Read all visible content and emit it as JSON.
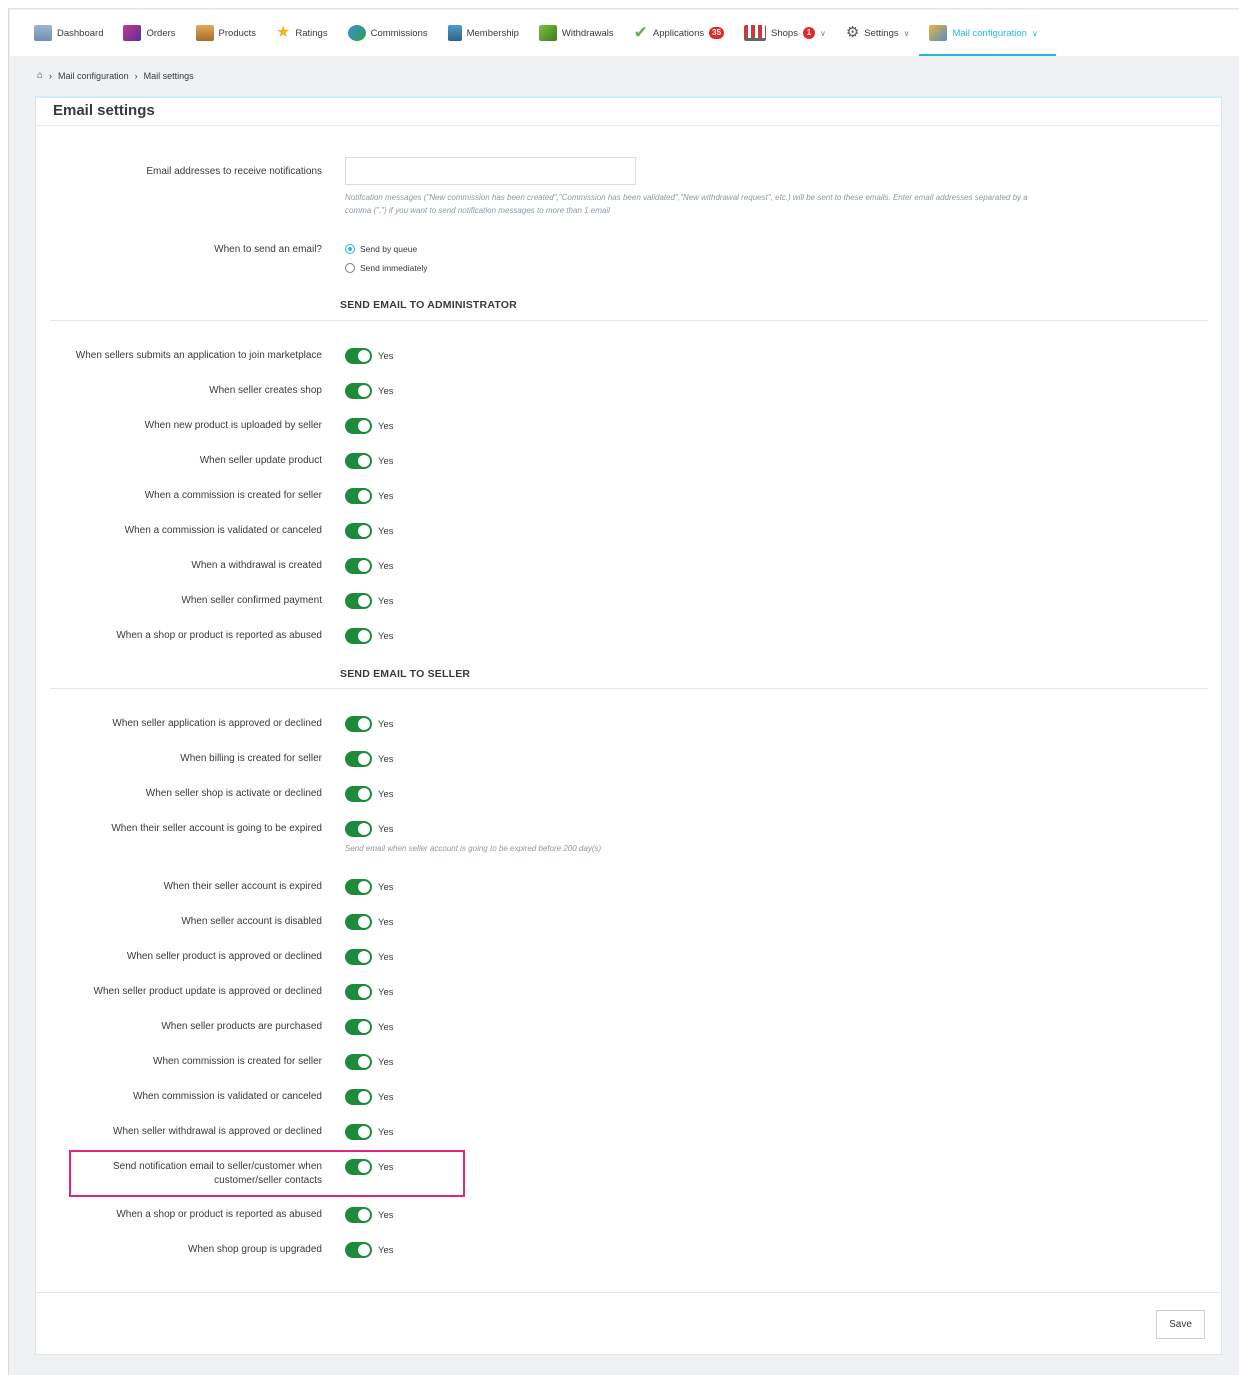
{
  "nav": {
    "items": [
      {
        "label": "Dashboard",
        "icon": "dashboard-icon",
        "color": "#6b8fb3"
      },
      {
        "label": "Orders",
        "icon": "orders-icon",
        "color": "#8a3b7a"
      },
      {
        "label": "Products",
        "icon": "products-icon",
        "color": "#c48a3e"
      },
      {
        "label": "Ratings",
        "icon": "star-icon",
        "color": "#f2b21c"
      },
      {
        "label": "Commissions",
        "icon": "commissions-icon",
        "color": "#3b8fd6"
      },
      {
        "label": "Membership",
        "icon": "membership-icon",
        "color": "#3a7fa8"
      },
      {
        "label": "Withdrawals",
        "icon": "withdrawals-icon",
        "color": "#5a9e2f"
      },
      {
        "label": "Applications",
        "icon": "applications-icon",
        "badge": "35",
        "color": "#6cae3d"
      },
      {
        "label": "Shops",
        "icon": "shops-icon",
        "badge": "1",
        "caret": true,
        "color": "#c43d3d"
      },
      {
        "label": "Settings",
        "icon": "settings-icon",
        "caret": true,
        "color": "#6a6a6a"
      },
      {
        "label": "Mail configuration",
        "icon": "mail-configuration-icon",
        "caret": true,
        "active": true,
        "color": "#4a90c8"
      }
    ]
  },
  "breadcrumb": {
    "home_icon": "home-icon",
    "items": [
      "Mail configuration",
      "Mail settings"
    ]
  },
  "panel": {
    "title": "Email settings"
  },
  "email_field": {
    "label": "Email addresses to receive notifications",
    "value": "",
    "help_line1": "Notifcation messages (\"New commission has been created\",\"Commission has been validated\",\"New withdrawal request\", etc.) will be sent to these emails. Enter email addresses separated by a",
    "help_line2": "comma (\",\") if you want to send notification messages to more than 1 email"
  },
  "send_when": {
    "label": "When to send an email?",
    "options": [
      {
        "label": "Send by queue",
        "selected": true
      },
      {
        "label": "Send immediately",
        "selected": false
      }
    ]
  },
  "admin_section": {
    "title": "SEND EMAIL TO ADMINISTRATOR",
    "rows": [
      {
        "label": "When sellers submits an application to join marketplace",
        "state": "Yes"
      },
      {
        "label": "When seller creates shop",
        "state": "Yes"
      },
      {
        "label": "When new product is uploaded by seller",
        "state": "Yes"
      },
      {
        "label": "When seller update product",
        "state": "Yes"
      },
      {
        "label": "When a commission is created for seller",
        "state": "Yes"
      },
      {
        "label": "When a commission is validated or canceled",
        "state": "Yes"
      },
      {
        "label": "When a withdrawal is created",
        "state": "Yes"
      },
      {
        "label": "When seller confirmed payment",
        "state": "Yes"
      },
      {
        "label": "When a shop or product is reported as abused",
        "state": "Yes"
      }
    ]
  },
  "seller_section": {
    "title": "SEND EMAIL TO SELLER",
    "rows": [
      {
        "label": "When seller application is approved or declined",
        "state": "Yes"
      },
      {
        "label": "When billing is created for seller",
        "state": "Yes"
      },
      {
        "label": "When seller shop is activate or declined",
        "state": "Yes"
      },
      {
        "label": "When their seller account is going to be expired",
        "state": "Yes",
        "help": "Send email when seller account is going to be expired before 200 day(s)"
      },
      {
        "label": "When their seller account is expired",
        "state": "Yes"
      },
      {
        "label": "When seller account is disabled",
        "state": "Yes"
      },
      {
        "label": "When seller product is approved or declined",
        "state": "Yes"
      },
      {
        "label": "When seller product update is approved or declined",
        "state": "Yes"
      },
      {
        "label": "When seller products are purchased",
        "state": "Yes"
      },
      {
        "label": "When commission is created for seller",
        "state": "Yes"
      },
      {
        "label": "When commission is validated or canceled",
        "state": "Yes"
      },
      {
        "label": "When seller withdrawal is approved or declined",
        "state": "Yes"
      },
      {
        "label_line1": "Send notification email to seller/customer when",
        "label_line2": "customer/seller contacts",
        "state": "Yes",
        "highlighted": true
      },
      {
        "label": "When a shop or product is reported as abused",
        "state": "Yes"
      },
      {
        "label": "When shop group is upgraded",
        "state": "Yes"
      }
    ]
  },
  "actions": {
    "save_label": "Save"
  },
  "colors": {
    "accent": "#25b9d7",
    "toggle_on": "#1e8a3c",
    "highlight": "#e0267a",
    "badge": "#e3282b"
  }
}
